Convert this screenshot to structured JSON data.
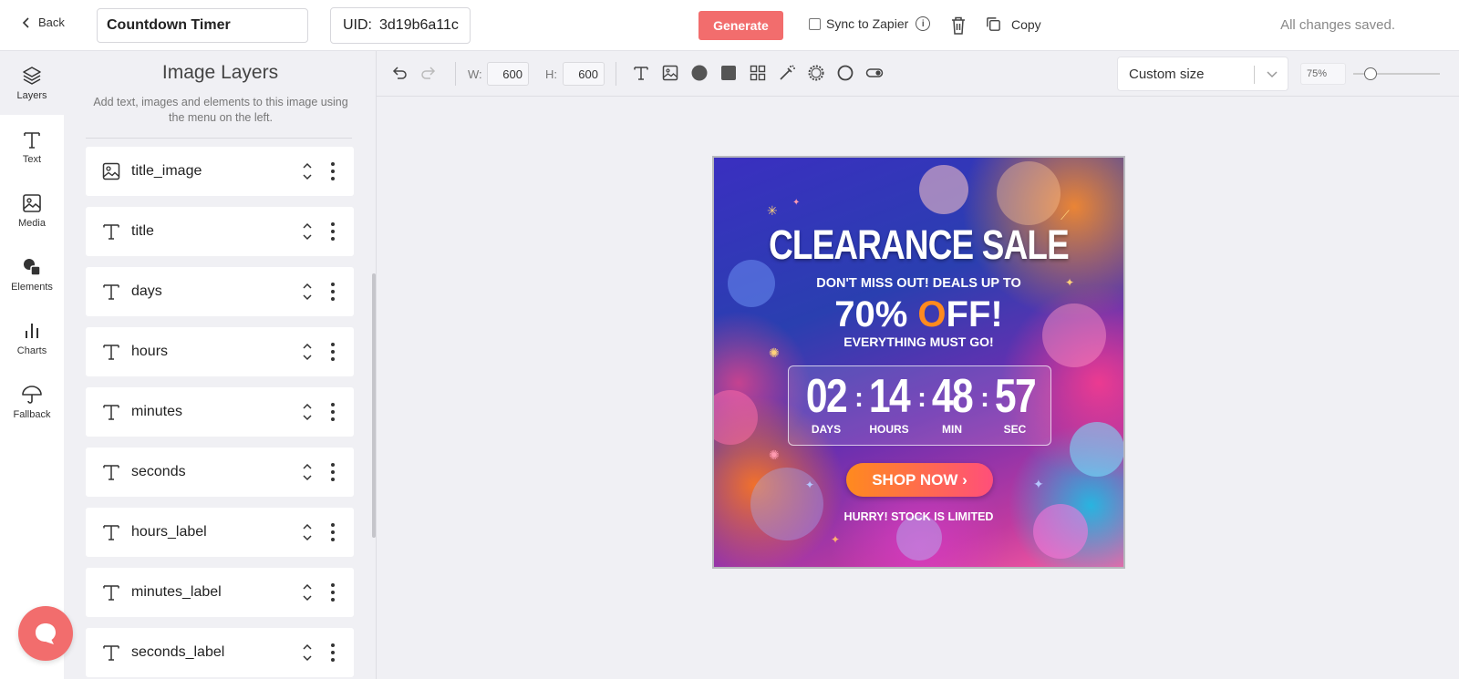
{
  "topbar": {
    "back_label": "Back",
    "template_name": "Countdown Timer",
    "uid_label": "UID:",
    "uid_value": "3d19b6a11c",
    "generate_label": "Generate",
    "sync_label": "Sync to Zapier",
    "copy_label": "Copy",
    "status": "All changes saved."
  },
  "rail": {
    "items": [
      {
        "label": "Layers",
        "icon": "layers-icon"
      },
      {
        "label": "Text",
        "icon": "text-icon"
      },
      {
        "label": "Media",
        "icon": "image-icon"
      },
      {
        "label": "Elements",
        "icon": "shapes-icon"
      },
      {
        "label": "Charts",
        "icon": "bar-chart-icon"
      },
      {
        "label": "Fallback",
        "icon": "umbrella-icon"
      }
    ]
  },
  "panel": {
    "title": "Image Layers",
    "subtitle": "Add text, images and elements to this image using the menu on the left.",
    "layers": [
      {
        "name": "title_image",
        "type": "image"
      },
      {
        "name": "title",
        "type": "text"
      },
      {
        "name": "days",
        "type": "text"
      },
      {
        "name": "hours",
        "type": "text"
      },
      {
        "name": "minutes",
        "type": "text"
      },
      {
        "name": "seconds",
        "type": "text"
      },
      {
        "name": "hours_label",
        "type": "text"
      },
      {
        "name": "minutes_label",
        "type": "text"
      },
      {
        "name": "seconds_label",
        "type": "text"
      }
    ]
  },
  "toolbar": {
    "width_label": "W:",
    "width_value": "600",
    "height_label": "H:",
    "height_value": "600",
    "size_preset": "Custom size",
    "zoom": "75%",
    "zoom_fraction": 0.2
  },
  "artboard": {
    "headline": "CLEARANCE SALE",
    "subline": "DON'T MISS OUT! DEALS UP TO",
    "offer_prefix": "70% ",
    "offer_o": "O",
    "offer_suffix": "FF!",
    "tagline": "EVERYTHING MUST GO!",
    "days": "02",
    "hours": "14",
    "minutes": "48",
    "seconds": "57",
    "days_label": "DAYS",
    "hours_label": "HOURS",
    "min_label": "MIN",
    "sec_label": "SEC",
    "cta": "SHOP NOW",
    "cta_arrow": "›",
    "footer": "HURRY! STOCK IS LIMITED"
  },
  "colors": {
    "accent": "#f26d6d",
    "cta_start": "#ff8a1e",
    "cta_end": "#ff4f7a"
  }
}
